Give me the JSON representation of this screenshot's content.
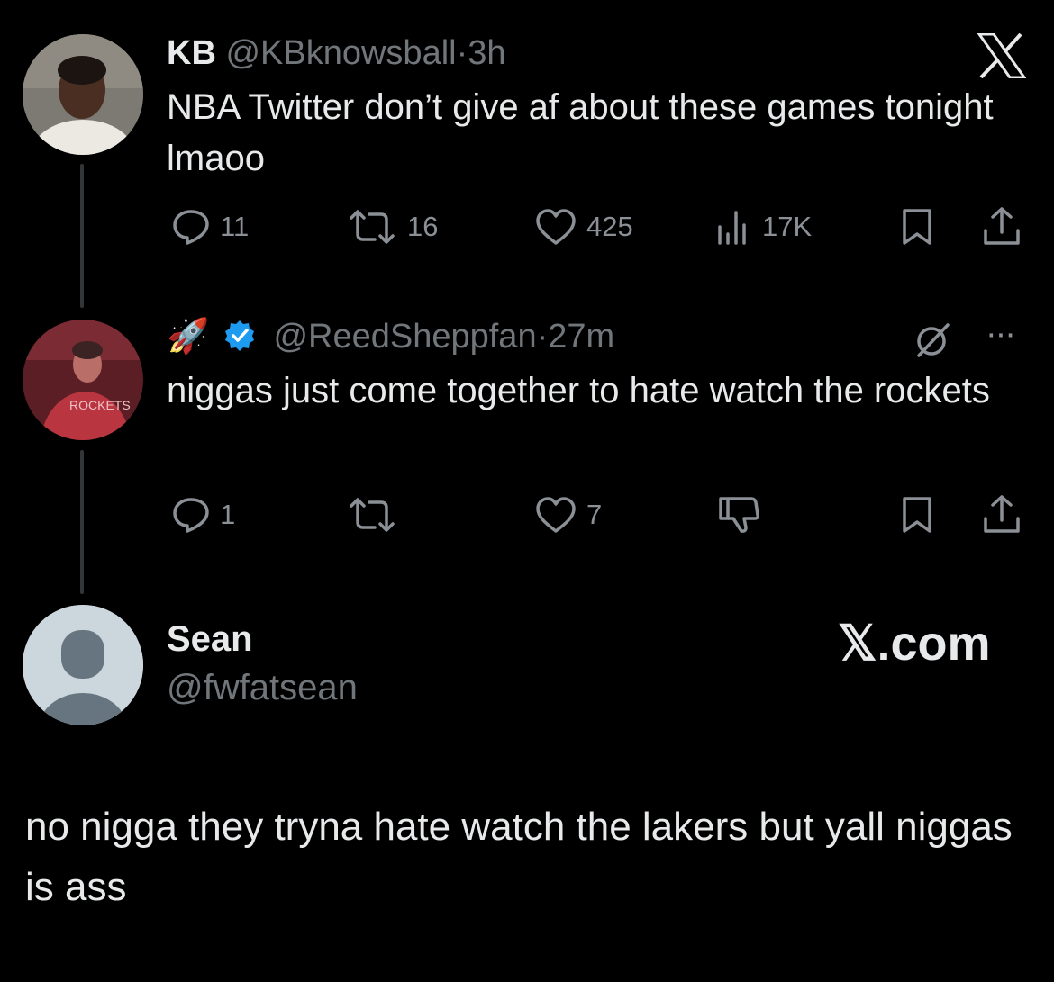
{
  "tweet1": {
    "display_name": "KB",
    "handle": "@KBknowsball",
    "separator": "·",
    "time": "3h",
    "text": "NBA Twitter don’t give af about these games tonight lmaoo",
    "replies": "11",
    "reposts": "16",
    "likes": "425",
    "views": "17K"
  },
  "tweet2": {
    "emoji": "🚀",
    "handle": "@ReedSheppfan",
    "separator": "·",
    "time": "27m",
    "text": "niggas just come together to hate watch the rockets",
    "replies": "1",
    "likes": "7",
    "more": "···"
  },
  "reply": {
    "display_name": "Sean",
    "handle": "@fwfatsean",
    "brand": "𝕏.com",
    "text": "no nigga they tryna hate watch the lakers but yall niggas is ass"
  },
  "colors": {
    "background": "#000000",
    "text": "#e7e9ea",
    "muted": "#71767b",
    "verified": "#1d9bf0"
  }
}
